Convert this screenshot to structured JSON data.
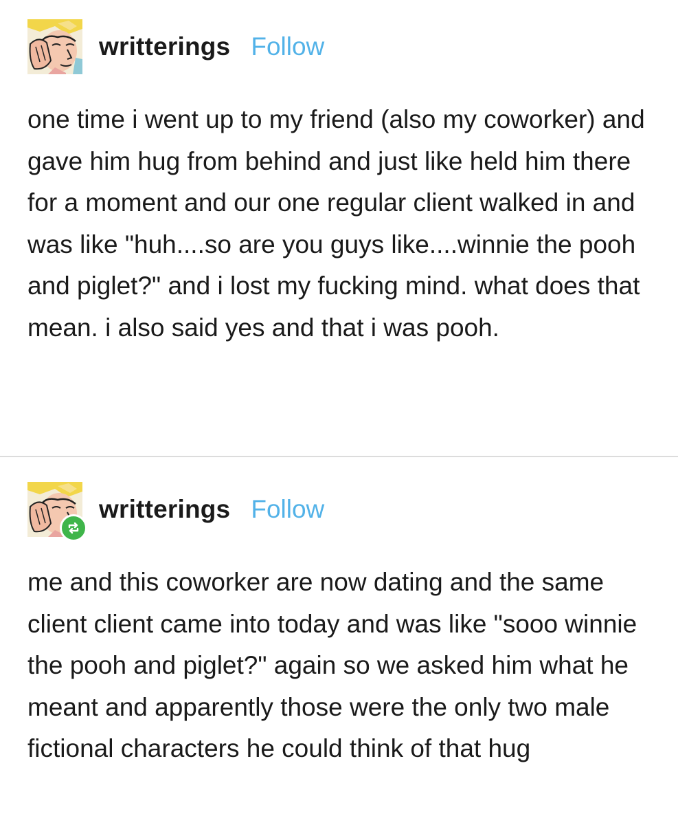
{
  "posts": [
    {
      "username": "writterings",
      "follow_label": "Follow",
      "avatar_icon": "comic-face-avatar-icon",
      "reblogged": false,
      "text": "one time i went up to my friend (also my coworker) and gave him hug from behind and just like held him there for a moment and our one regular client walked in and was like \"huh....so are you guys like....winnie the pooh and piglet?\" and i lost my fucking mind. what does that mean. i also said yes and that i was pooh."
    },
    {
      "username": "writterings",
      "follow_label": "Follow",
      "avatar_icon": "comic-face-avatar-icon",
      "reblogged": true,
      "badge_icon": "reblog-icon",
      "text": "me and this coworker are now dating and the same client client came into today and was like \"sooo winnie the pooh and piglet?\" again so we asked him what he meant and apparently those were the only two male fictional characters he could think of that hug"
    }
  ],
  "colors": {
    "follow": "#52b2e8",
    "reblog_badge": "#3fb54a",
    "text": "#1a1a1a",
    "divider": "#dcdcdc"
  }
}
